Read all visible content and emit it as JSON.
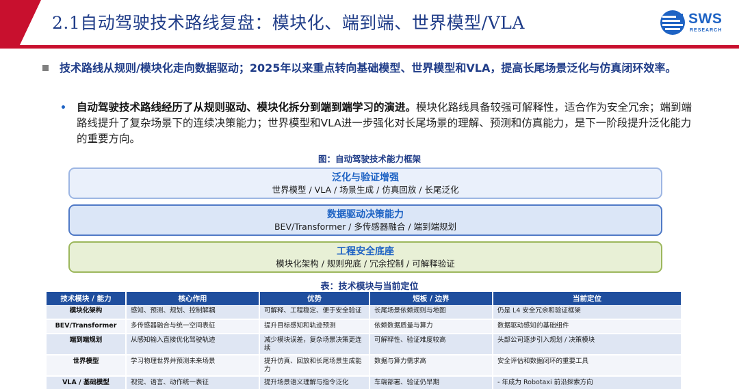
{
  "header": {
    "title": "2.1自动驾驶技术路线复盘：模块化、端到端、世界模型/VLA",
    "logo_text": "SWS",
    "logo_sub": "RESEARCH",
    "colors": {
      "red": "#c8102e",
      "title_blue": "#1f3c88",
      "logo_blue": "#1e63c4"
    }
  },
  "bullets": {
    "main": "技术路线从规则/模块化走向数据驱动；2025年以来重点转向基础模型、世界模型和VLA，提高长尾场景泛化与仿真闭环效率。",
    "sub_bold": "自动驾驶技术路线经历了从规则驱动、模块化拆分到端到端学习的演进。",
    "sub_rest": "模块化路线具备较强可解释性，适合作为安全冗余；端到端路线提升了复杂场景下的连续决策能力；世界模型和VLA进一步强化对长尾场景的理解、预测和仿真能力，是下一阶段提升泛化能力的重要方向。"
  },
  "figure": {
    "caption": "图：自动驾驶技术能力框架",
    "layers": [
      {
        "title": "泛化与验证增强",
        "desc": "世界模型 / VLA / 场景生成 / 仿真回放 / 长尾泛化"
      },
      {
        "title": "数据驱动决策能力",
        "desc": "BEV/Transformer / 多传感器融合 / 端到端规划"
      },
      {
        "title": "工程安全底座",
        "desc": "模块化架构 / 规则兜底 / 冗余控制 / 可解释验证"
      }
    ]
  },
  "table": {
    "caption": "表：技术模块与当前定位",
    "headers": [
      "技术模块 / 能力",
      "核心作用",
      "优势",
      "短板 / 边界",
      "当前定位"
    ],
    "rows": [
      [
        "模块化架构",
        "感知、预测、规划、控制解耦",
        "可解释、工程稳定、便于安全验证",
        "长尾场景依赖规则与地图",
        "仍是 L4 安全冗余和验证框架"
      ],
      [
        "BEV/Transformer",
        "多传感器融合与统一空间表征",
        "提升目标感知和轨迹预测",
        "依赖数据质量与算力",
        "数据驱动感知的基础组件"
      ],
      [
        "端到端规划",
        "从感知输入直接优化驾驶轨迹",
        "减少模块误差，复杂场景决策更连续",
        "可解释性、验证难度较高",
        "头部公司逐步引入规划 / 决策模块"
      ],
      [
        "世界模型",
        "学习物理世界并预测未来场景",
        "提升仿真、回放和长尾场景生成能力",
        "数据与算力需求高",
        "安全评估和数据闭环的重要工具"
      ],
      [
        "VLA / 基础模型",
        "视觉、语言、动作统一表征",
        "提升场景语义理解与指令泛化",
        "车端部署、验证仍早期",
        "-    年成为 Robotaxi 前沿探索方向"
      ]
    ]
  }
}
